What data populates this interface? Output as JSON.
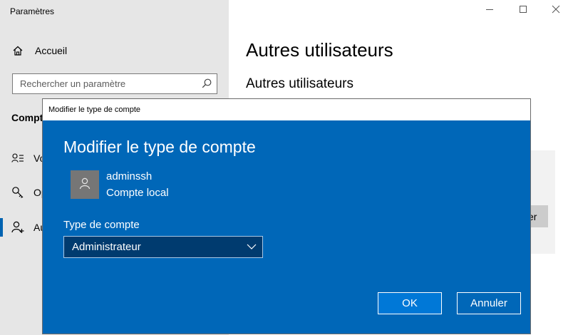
{
  "window": {
    "title": "Paramètres",
    "controls": [
      "minimize-icon",
      "maximize-icon",
      "close-icon"
    ]
  },
  "sidebar": {
    "home_label": "Accueil",
    "search_placeholder": "Rechercher un paramètre",
    "section_heading": "Compt",
    "items": [
      {
        "label": "Vo",
        "icon": "person-list-icon"
      },
      {
        "label": "Op",
        "icon": "key-icon"
      },
      {
        "label": "Au",
        "icon": "add-person-icon",
        "active": true
      }
    ]
  },
  "main": {
    "title": "Autres utilisateurs",
    "subtitle": "Autres utilisateurs",
    "partial_button_label": "er"
  },
  "dialog": {
    "window_title": "Modifier le type de compte",
    "heading": "Modifier le type de compte",
    "user": {
      "name": "adminssh",
      "account_type": "Compte local"
    },
    "type_label": "Type de compte",
    "selected_type": "Administrateur",
    "ok_label": "OK",
    "cancel_label": "Annuler"
  },
  "colors": {
    "dialog_background": "#0067b8",
    "ok_button": "#0078d7",
    "select_background": "#003b6f",
    "sidebar_background": "#e6e6e6",
    "accent": "#0063b1"
  }
}
